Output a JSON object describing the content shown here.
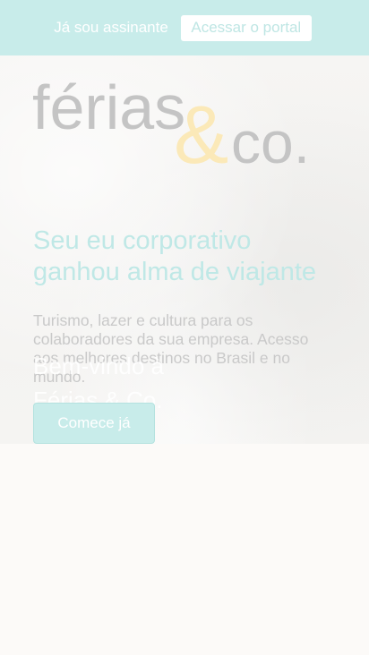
{
  "topbar": {
    "subscriber_text": "Já sou assinante",
    "portal_button": "Acessar o portal"
  },
  "logo": {
    "word": "férias",
    "ampersand": "&",
    "suffix": "co."
  },
  "hero": {
    "headline_line1": "Seu eu corporativo",
    "headline_line2": "ganhou alma de viajante",
    "subtext": "Turismo, lazer e cultura para os colaboradores da sua empresa. Acesso aos melhores destinos no Brasil e no mundo.",
    "ghost_line1": "Bem-vindo à",
    "ghost_line2": "Férias & Co.",
    "cta_label": "Comece já"
  },
  "colors": {
    "accent": "#c8ecea",
    "logo_gray": "#c4c4c4",
    "logo_yellow": "#fbe9b8",
    "headline": "#bfe8e6"
  }
}
